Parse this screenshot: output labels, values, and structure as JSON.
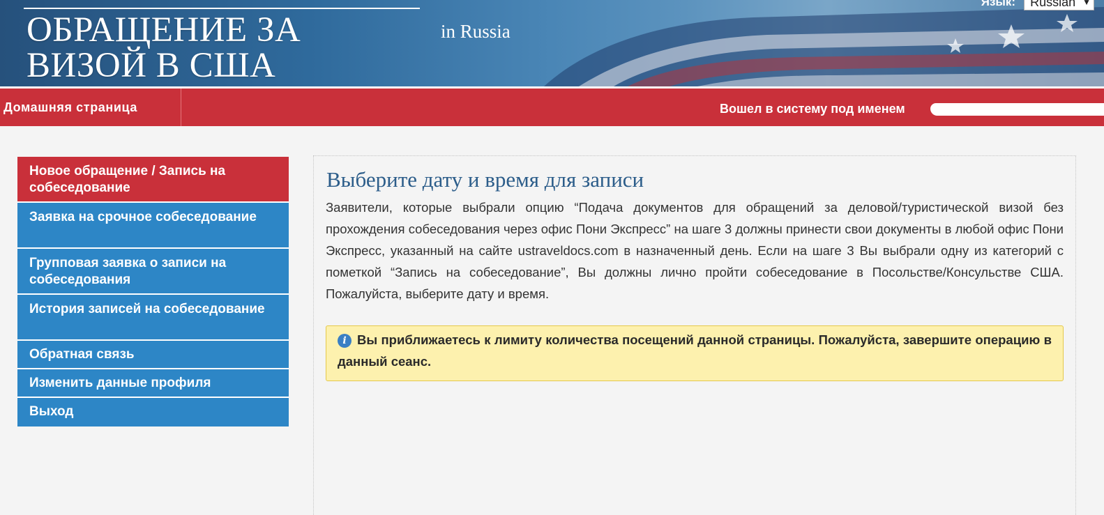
{
  "header": {
    "title_line1": "ОБРАЩЕНИЕ ЗА",
    "title_line2": "ВИЗОЙ В США",
    "country": "in  Russia",
    "language_label": "Язык:",
    "language_value": "Russian"
  },
  "navbar": {
    "home": "Домашняя страница",
    "logged_in": "Вошел в систему под именем"
  },
  "sidebar": {
    "items": [
      {
        "label": "Новое обращение / Запись на собеседование"
      },
      {
        "label": "Заявка на срочное собеседование"
      },
      {
        "label": "Групповая заявка о записи на собеседования"
      },
      {
        "label": "История записей на собеседование"
      },
      {
        "label": "Обратная связь"
      },
      {
        "label": "Изменить данные профиля"
      },
      {
        "label": "Выход"
      }
    ]
  },
  "main": {
    "heading": "Выберите дату и время для записи",
    "description": "Заявители, которые выбрали опцию “Подача документов для обращений за деловой/туристической визой без прохождения собеседования через офис Пони Экспресс” на шаге 3 должны принести свои документы в любой офис Пони Экспресс, указанный на сайте ustraveldocs.com в назначенный день. Если на шаге 3 Вы выбрали одну из категорий с пометкой “Запись на собеседование”, Вы должны лично пройти собеседование в Посольстве/Консульстве США. Пожалуйста, выберите дату и время.",
    "notice": "Вы приближаетесь к лимиту количества посещений данной страницы. Пожалуйста, завершите операцию в данный сеанс."
  },
  "colors": {
    "nav_red": "#c9303a",
    "sidebar_blue": "#2d86c6",
    "heading_blue": "#2c5d8a",
    "notice_bg": "#fdf1ae"
  },
  "icons": {
    "notice": "info-icon",
    "language": "chevron-down-icon"
  }
}
